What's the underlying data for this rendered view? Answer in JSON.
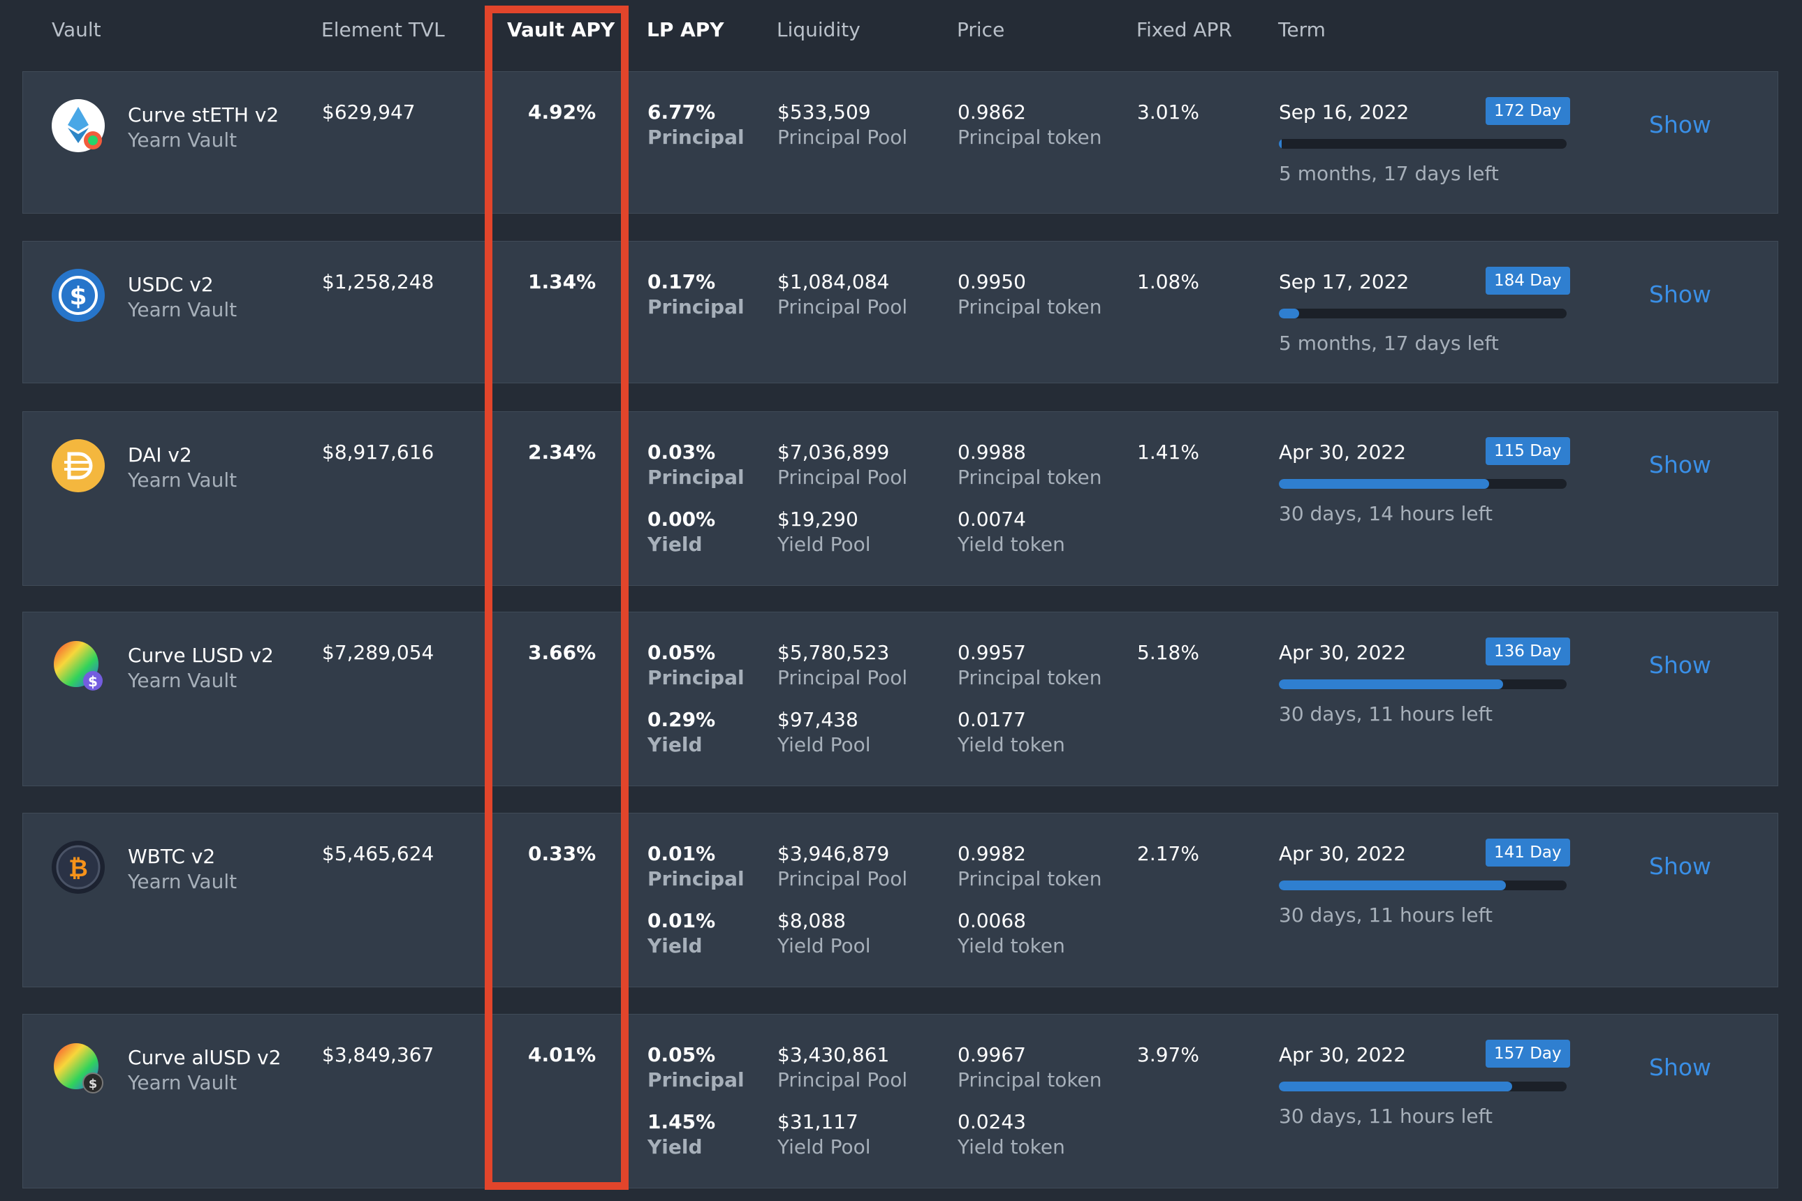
{
  "headers": {
    "vault": "Vault",
    "tvl": "Element TVL",
    "vault_apy": "Vault APY",
    "lp_apy": "LP APY",
    "liquidity": "Liquidity",
    "price": "Price",
    "fixed_apr": "Fixed APR",
    "term": "Term"
  },
  "colors": {
    "accent": "#2f7fd0",
    "highlight": "#e2452b",
    "link": "#3a8fe6"
  },
  "rows": [
    {
      "icon": "steth-icon",
      "name": "Curve stETH v2",
      "kind": "Yearn Vault",
      "tvl": "$629,947",
      "vault_apy": "4.92%",
      "lp_principal": "6.77%",
      "lp_principal_label": "Principal",
      "liq_principal": "$533,509",
      "liq_principal_label": "Principal Pool",
      "price_principal": "0.9862",
      "price_principal_label": "Principal token",
      "fixed_apr": "3.01%",
      "term_date": "Sep 16, 2022",
      "term_badge": "172 Day",
      "progress": 0.01,
      "time_left": "5 months, 17 days left",
      "show": "Show"
    },
    {
      "icon": "usdc-icon",
      "name": "USDC v2",
      "kind": "Yearn Vault",
      "tvl": "$1,258,248",
      "vault_apy": "1.34%",
      "lp_principal": "0.17%",
      "lp_principal_label": "Principal",
      "liq_principal": "$1,084,084",
      "liq_principal_label": "Principal Pool",
      "price_principal": "0.9950",
      "price_principal_label": "Principal token",
      "fixed_apr": "1.08%",
      "term_date": "Sep 17, 2022",
      "term_badge": "184 Day",
      "progress": 0.07,
      "time_left": "5 months, 17 days left",
      "show": "Show"
    },
    {
      "icon": "dai-icon",
      "name": "DAI v2",
      "kind": "Yearn Vault",
      "tvl": "$8,917,616",
      "vault_apy": "2.34%",
      "lp_principal": "0.03%",
      "lp_principal_label": "Principal",
      "liq_principal": "$7,036,899",
      "liq_principal_label": "Principal Pool",
      "price_principal": "0.9988",
      "price_principal_label": "Principal token",
      "lp_yield": "0.00%",
      "lp_yield_label": "Yield",
      "liq_yield": "$19,290",
      "liq_yield_label": "Yield Pool",
      "price_yield": "0.0074",
      "price_yield_label": "Yield token",
      "fixed_apr": "1.41%",
      "term_date": "Apr 30, 2022",
      "term_badge": "115 Day",
      "progress": 0.73,
      "time_left": "30 days, 14 hours left",
      "show": "Show"
    },
    {
      "icon": "curve-lusd-icon",
      "name": "Curve LUSD v2",
      "kind": "Yearn Vault",
      "tvl": "$7,289,054",
      "vault_apy": "3.66%",
      "lp_principal": "0.05%",
      "lp_principal_label": "Principal",
      "liq_principal": "$5,780,523",
      "liq_principal_label": "Principal Pool",
      "price_principal": "0.9957",
      "price_principal_label": "Principal token",
      "lp_yield": "0.29%",
      "lp_yield_label": "Yield",
      "liq_yield": "$97,438",
      "liq_yield_label": "Yield Pool",
      "price_yield": "0.0177",
      "price_yield_label": "Yield token",
      "fixed_apr": "5.18%",
      "term_date": "Apr 30, 2022",
      "term_badge": "136 Day",
      "progress": 0.78,
      "time_left": "30 days, 11 hours left",
      "show": "Show"
    },
    {
      "icon": "wbtc-icon",
      "name": "WBTC v2",
      "kind": "Yearn Vault",
      "tvl": "$5,465,624",
      "vault_apy": "0.33%",
      "lp_principal": "0.01%",
      "lp_principal_label": "Principal",
      "liq_principal": "$3,946,879",
      "liq_principal_label": "Principal Pool",
      "price_principal": "0.9982",
      "price_principal_label": "Principal token",
      "lp_yield": "0.01%",
      "lp_yield_label": "Yield",
      "liq_yield": "$8,088",
      "liq_yield_label": "Yield Pool",
      "price_yield": "0.0068",
      "price_yield_label": "Yield token",
      "fixed_apr": "2.17%",
      "term_date": "Apr 30, 2022",
      "term_badge": "141 Day",
      "progress": 0.79,
      "time_left": "30 days, 11 hours left",
      "show": "Show"
    },
    {
      "icon": "curve-alusd-icon",
      "name": "Curve alUSD v2",
      "kind": "Yearn Vault",
      "tvl": "$3,849,367",
      "vault_apy": "4.01%",
      "lp_principal": "0.05%",
      "lp_principal_label": "Principal",
      "liq_principal": "$3,430,861",
      "liq_principal_label": "Principal Pool",
      "price_principal": "0.9967",
      "price_principal_label": "Principal token",
      "lp_yield": "1.45%",
      "lp_yield_label": "Yield",
      "liq_yield": "$31,117",
      "liq_yield_label": "Yield Pool",
      "price_yield": "0.0243",
      "price_yield_label": "Yield token",
      "fixed_apr": "3.97%",
      "term_date": "Apr 30, 2022",
      "term_badge": "157 Day",
      "progress": 0.81,
      "time_left": "30 days, 11 hours left",
      "show": "Show"
    }
  ]
}
